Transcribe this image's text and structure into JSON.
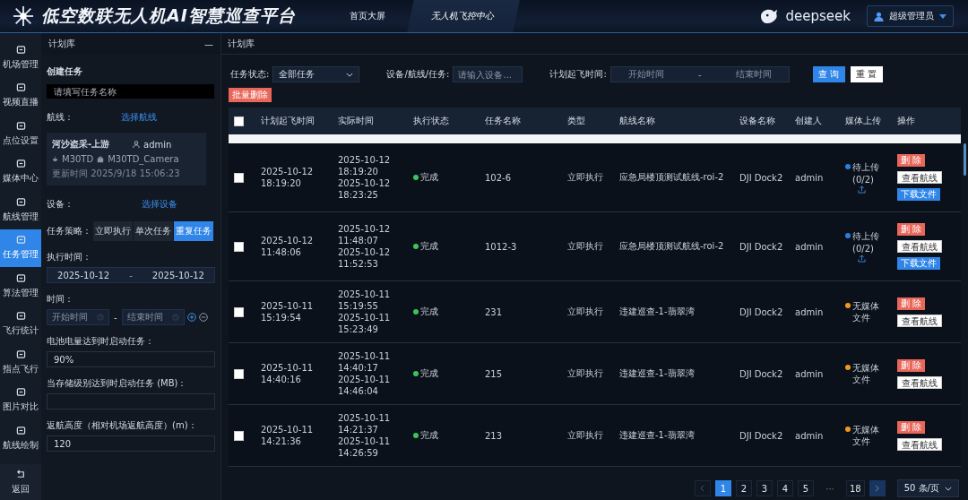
{
  "header": {
    "title": "低空数联无人机AI智慧巡查平台",
    "tabs": [
      {
        "label": "首页大屏",
        "selected": false
      },
      {
        "label": "无人机飞控中心",
        "selected": true
      }
    ],
    "brand": "deepseek",
    "user": "超级管理员"
  },
  "nav": {
    "items": [
      {
        "label": "机场管理",
        "selected": false
      },
      {
        "label": "视频直播",
        "selected": false
      },
      {
        "label": "点位设置",
        "selected": false
      },
      {
        "label": "媒体中心",
        "selected": false
      },
      {
        "label": "航线管理",
        "selected": false
      },
      {
        "label": "任务管理",
        "selected": true
      },
      {
        "label": "算法管理",
        "selected": false
      },
      {
        "label": "飞行统计",
        "selected": false
      },
      {
        "label": "指点飞行",
        "selected": false
      },
      {
        "label": "图片对比",
        "selected": false
      },
      {
        "label": "航线绘制",
        "selected": false
      }
    ],
    "back": "返回"
  },
  "plan_panel": {
    "title": "计划库",
    "collapse": "—",
    "section": "创建任务",
    "name_placeholder": "请填写任务名称",
    "route_label": "航线：",
    "route_link": "选择航线",
    "route_card": {
      "name": "河沙盗采-上游",
      "creator": "admin",
      "drone": "M30TD",
      "camera": "M30TD_Camera",
      "updated": "更新时间 2025/9/18 15:06:23"
    },
    "device_label": "设备：",
    "device_link": "选择设备",
    "strategy_label": "任务策略：",
    "strategies": [
      {
        "label": "立即执行",
        "selected": false
      },
      {
        "label": "单次任务",
        "selected": false
      },
      {
        "label": "重复任务",
        "selected": true
      }
    ],
    "exec_label": "执行时间：",
    "exec_start": "2025-10-12",
    "exec_sep": "-",
    "exec_end": "2025-10-12",
    "time_label": "时间：",
    "time_start_placeholder": "开始时间",
    "time_sep": "-",
    "time_end_placeholder": "结束时间",
    "battery_label": "电池电量达到时启动任务：",
    "battery_value": "90%",
    "storage_label": "当存储级别达到时启动任务 (MB)：",
    "altitude_label": "返航高度（相对机场返航高度）(m)：",
    "altitude_value": "120"
  },
  "main": {
    "breadcrumb": "计划库",
    "filters": {
      "status_label": "任务状态:",
      "status_value": "全部任务",
      "search_label": "设备/航线/任务:",
      "search_placeholder": "请输入设备...",
      "time_label": "计划起飞时间:",
      "start_placeholder": "开始时间",
      "sep": "-",
      "end_placeholder": "结束时间",
      "query": "查 询",
      "reset": "重 置"
    },
    "batch_delete": "批量删除",
    "table": {
      "header_checked": false,
      "columns": [
        "计划起飞时间",
        "实际时间",
        "执行状态",
        "任务名称",
        "类型",
        "航线名称",
        "设备名称",
        "创建人",
        "媒体上传",
        "操作"
      ],
      "rows": [
        {
          "checked": false,
          "planned": [
            "2025-10-12",
            "18:19:20"
          ],
          "actual": [
            "2025-10-12",
            "18:19:20",
            "2025-10-12",
            "18:23:25"
          ],
          "status": "完成",
          "name": "102-6",
          "type": "立即执行",
          "route": "应急局楼顶测试航线-roi-2",
          "device": "DJI Dock2",
          "creator": "admin",
          "media": {
            "kind": "pending",
            "color": "#2f7de1",
            "text": "待上传",
            "count": "(0/2)"
          },
          "actions": [
            {
              "kind": "delete",
              "label": "删 除"
            },
            {
              "kind": "view",
              "label": "查看航线"
            },
            {
              "kind": "download",
              "label": "下载文件"
            }
          ]
        },
        {
          "checked": false,
          "planned": [
            "2025-10-12",
            "11:48:06"
          ],
          "actual": [
            "2025-10-12",
            "11:48:07",
            "2025-10-12",
            "11:52:53"
          ],
          "status": "完成",
          "name": "1012-3",
          "type": "立即执行",
          "route": "应急局楼顶测试航线-roi-2",
          "device": "DJI Dock2",
          "creator": "admin",
          "media": {
            "kind": "pending",
            "color": "#2f7de1",
            "text": "待上传",
            "count": "(0/2)"
          },
          "actions": [
            {
              "kind": "delete",
              "label": "删 除"
            },
            {
              "kind": "view",
              "label": "查看航线"
            },
            {
              "kind": "download",
              "label": "下载文件"
            }
          ]
        },
        {
          "checked": false,
          "planned": [
            "2025-10-11",
            "15:19:54"
          ],
          "actual": [
            "2025-10-11",
            "15:19:55",
            "2025-10-11",
            "15:23:49"
          ],
          "status": "完成",
          "name": "231",
          "type": "立即执行",
          "route": "违建巡查-1-翡翠湾",
          "device": "DJI Dock2",
          "creator": "admin",
          "media": {
            "kind": "none",
            "color": "#f0981f",
            "text": "无媒体文件"
          },
          "actions": [
            {
              "kind": "delete",
              "label": "删 除"
            },
            {
              "kind": "view",
              "label": "查看航线"
            }
          ]
        },
        {
          "checked": false,
          "planned": [
            "2025-10-11",
            "14:40:16"
          ],
          "actual": [
            "2025-10-11",
            "14:40:17",
            "2025-10-11",
            "14:46:04"
          ],
          "status": "完成",
          "name": "215",
          "type": "立即执行",
          "route": "违建巡查-1-翡翠湾",
          "device": "DJI Dock2",
          "creator": "admin",
          "media": {
            "kind": "none",
            "color": "#f0981f",
            "text": "无媒体文件"
          },
          "actions": [
            {
              "kind": "delete",
              "label": "删 除"
            },
            {
              "kind": "view",
              "label": "查看航线"
            }
          ]
        },
        {
          "checked": false,
          "planned": [
            "2025-10-11",
            "14:21:36"
          ],
          "actual": [
            "2025-10-11",
            "14:21:37",
            "2025-10-11",
            "14:26:59"
          ],
          "status": "完成",
          "name": "213",
          "type": "立即执行",
          "route": "违建巡查-1-翡翠湾",
          "device": "DJI Dock2",
          "creator": "admin",
          "media": {
            "kind": "none",
            "color": "#f0981f",
            "text": "无媒体文件"
          },
          "actions": [
            {
              "kind": "delete",
              "label": "删 除"
            },
            {
              "kind": "view",
              "label": "查看航线"
            }
          ]
        }
      ]
    },
    "pagination": {
      "pages": [
        {
          "label": "1",
          "selected": true
        },
        {
          "label": "2",
          "selected": false
        },
        {
          "label": "3",
          "selected": false
        },
        {
          "label": "4",
          "selected": false
        },
        {
          "label": "5",
          "selected": false
        }
      ],
      "ellipsis": "···",
      "last": "18",
      "page_size": "50 条/页"
    }
  }
}
